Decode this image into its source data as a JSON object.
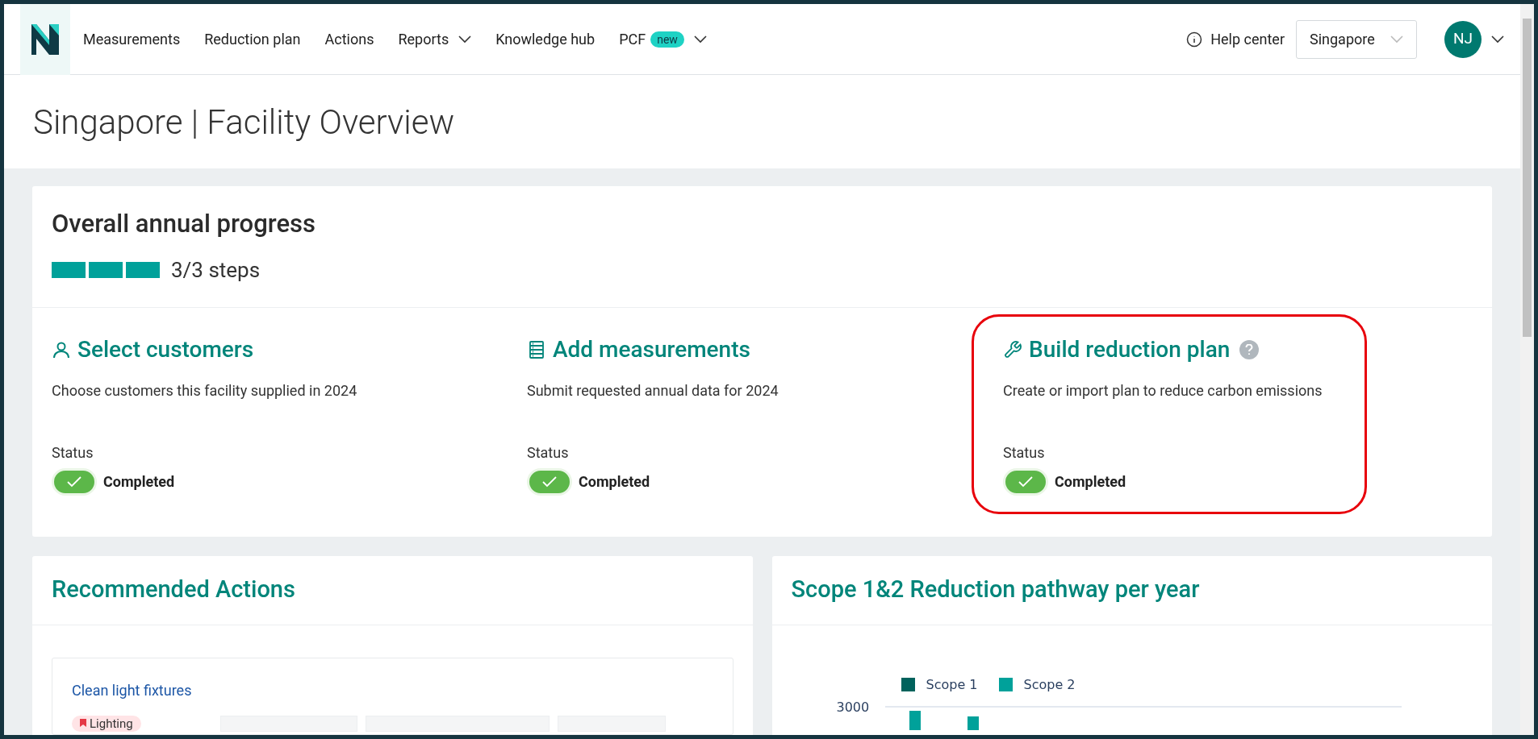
{
  "nav": {
    "items": [
      {
        "label": "Measurements",
        "dropdown": false
      },
      {
        "label": "Reduction plan",
        "dropdown": false
      },
      {
        "label": "Actions",
        "dropdown": false
      },
      {
        "label": "Reports",
        "dropdown": true
      },
      {
        "label": "Knowledge hub",
        "dropdown": false
      },
      {
        "label": "PCF",
        "dropdown": true,
        "badge": "new"
      }
    ],
    "help": "Help center",
    "location": "Singapore",
    "avatar": "NJ"
  },
  "page_title": "Singapore | Facility Overview",
  "progress": {
    "title": "Overall annual progress",
    "segments": [
      {
        "done": true
      },
      {
        "done": true
      },
      {
        "done": true
      }
    ],
    "label": "3/3 steps",
    "steps": [
      {
        "kind": "customers",
        "title": "Select customers",
        "description": "Choose customers this facility supplied in 2024",
        "status_label": "Status",
        "status": "Completed",
        "completed": true,
        "help": false,
        "highlighted": false
      },
      {
        "kind": "measurements",
        "title": "Add measurements",
        "description": "Submit requested annual data for 2024",
        "status_label": "Status",
        "status": "Completed",
        "completed": true,
        "help": false,
        "highlighted": false
      },
      {
        "kind": "plan",
        "title": "Build reduction plan",
        "description": "Create or import plan to reduce carbon emissions",
        "status_label": "Status",
        "status": "Completed",
        "completed": true,
        "help": true,
        "highlighted": true
      }
    ]
  },
  "recommended": {
    "title": "Recommended Actions",
    "action": {
      "title": "Clean light fixtures",
      "tag": "Lighting"
    }
  },
  "pathway": {
    "title": "Scope 1&2 Reduction pathway per year",
    "legend": [
      {
        "name": "Scope 1",
        "color": "#00625c"
      },
      {
        "name": "Scope 2",
        "color": "#00a19a"
      }
    ],
    "ytick": "3000"
  }
}
